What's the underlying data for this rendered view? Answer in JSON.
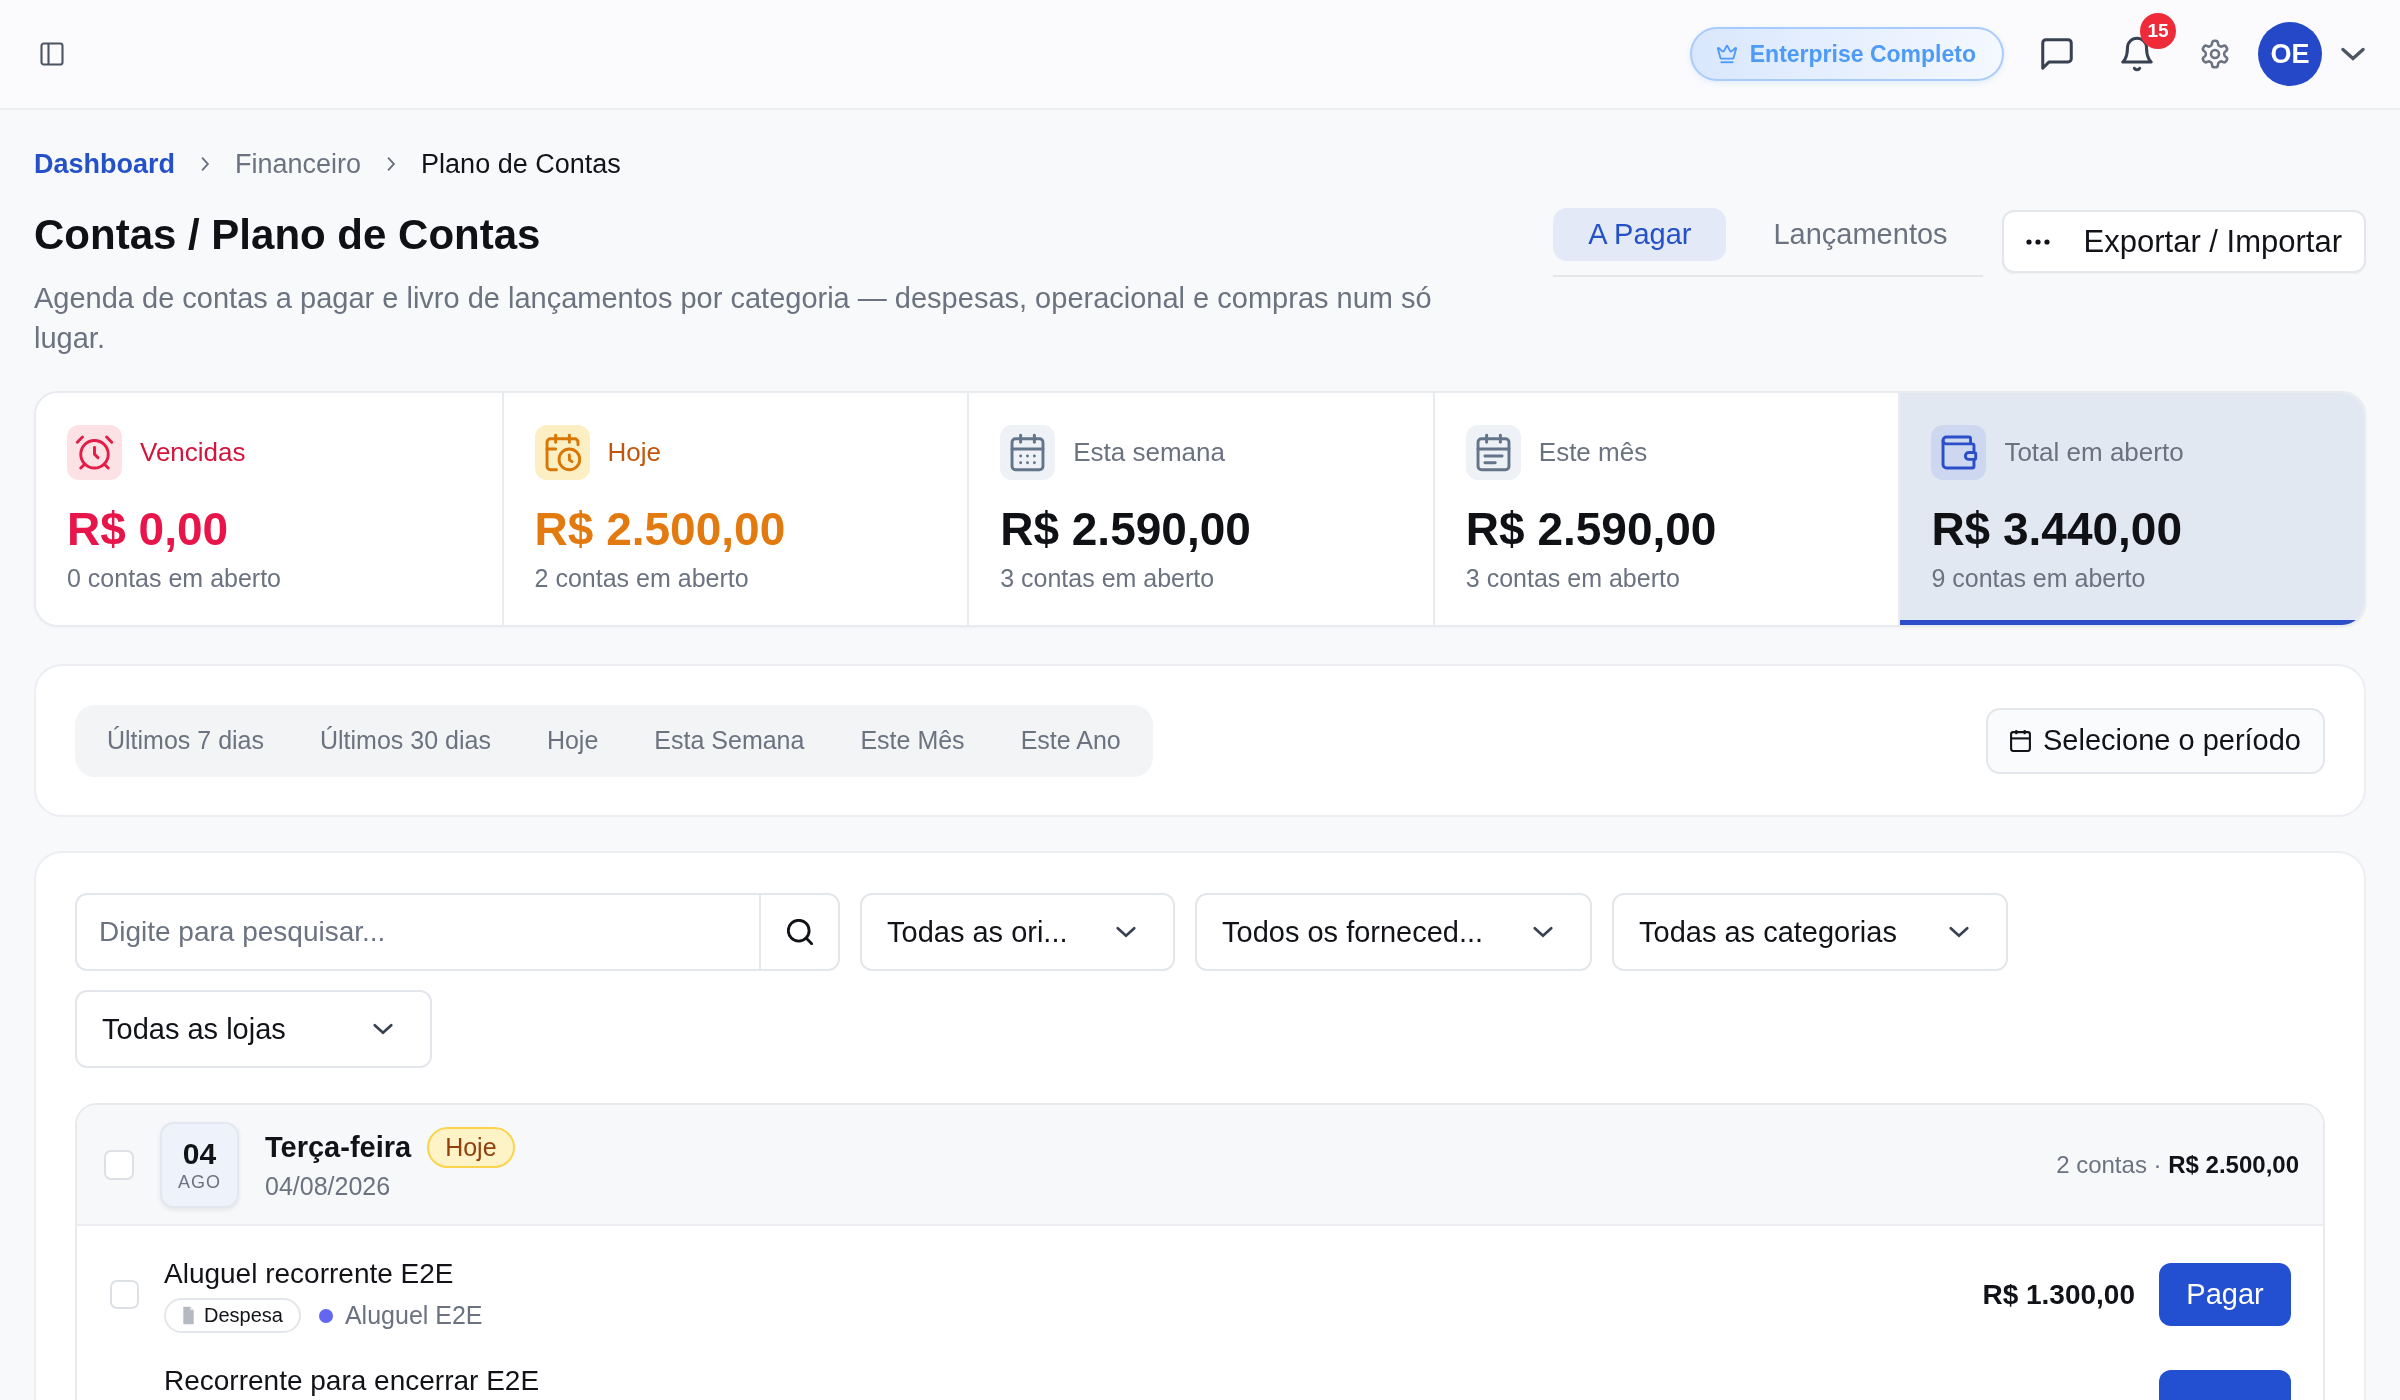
{
  "topbar": {
    "plan_badge": "Enterprise Completo",
    "notification_count": "15",
    "avatar_initials": "OE"
  },
  "breadcrumb": [
    {
      "label": "Dashboard",
      "kind": "link"
    },
    {
      "label": "Financeiro",
      "kind": "section"
    },
    {
      "label": "Plano de Contas",
      "kind": "current"
    }
  ],
  "header": {
    "title": "Contas / Plano de Contas",
    "description": "Agenda de contas a pagar e livro de lançamentos por categoria — despesas, operacional e compras num só lugar.",
    "tabs": [
      {
        "label": "A Pagar",
        "selected": true
      },
      {
        "label": "Lançamentos",
        "selected": false
      }
    ],
    "actions_button": "Exportar / Importar"
  },
  "summary_cards": [
    {
      "kind": "overdue",
      "label": "Vencidas",
      "value": "R$ 0,00",
      "subtitle": "0 contas em aberto",
      "selected": false
    },
    {
      "kind": "today",
      "label": "Hoje",
      "value": "R$ 2.500,00",
      "subtitle": "2 contas em aberto",
      "selected": false
    },
    {
      "kind": "week",
      "label": "Esta semana",
      "value": "R$ 2.590,00",
      "subtitle": "3 contas em aberto",
      "selected": false
    },
    {
      "kind": "month",
      "label": "Este mês",
      "value": "R$ 2.590,00",
      "subtitle": "3 contas em aberto",
      "selected": false
    },
    {
      "kind": "total",
      "label": "Total em aberto",
      "value": "R$ 3.440,00",
      "subtitle": "9 contas em aberto",
      "selected": true
    }
  ],
  "period_filter": {
    "presets": [
      {
        "label": "Últimos 7 dias",
        "selected": false
      },
      {
        "label": "Últimos 30 dias",
        "selected": false
      },
      {
        "label": "Hoje",
        "selected": false
      },
      {
        "label": "Esta Semana",
        "selected": false
      },
      {
        "label": "Este Mês",
        "selected": false
      },
      {
        "label": "Este Ano",
        "selected": false
      }
    ],
    "date_button": "Selecione o período"
  },
  "filters": {
    "search_placeholder": "Digite para pesquisar...",
    "selects": [
      "Todas as ori...",
      "Todos os forneced...",
      "Todas as categorias",
      "Todas as lojas"
    ]
  },
  "day_groups": [
    {
      "day": "04",
      "month": "AGO",
      "weekday": "Terça-feira",
      "badge": "Hoje",
      "date": "04/08/2026",
      "summary": "2 contas · **R$ 2.500,00**",
      "checked": false,
      "items": [
        {
          "title": "Aluguel recorrente E2E",
          "checked": false,
          "type_tag": "Despesa",
          "category": {
            "label": "Aluguel E2E",
            "color": "#6366f1"
          },
          "amount": "R$ 1.300,00",
          "action": "Pagar"
        },
        {
          "title": "Recorrente para encerrar E2E"
        }
      ]
    }
  ]
}
